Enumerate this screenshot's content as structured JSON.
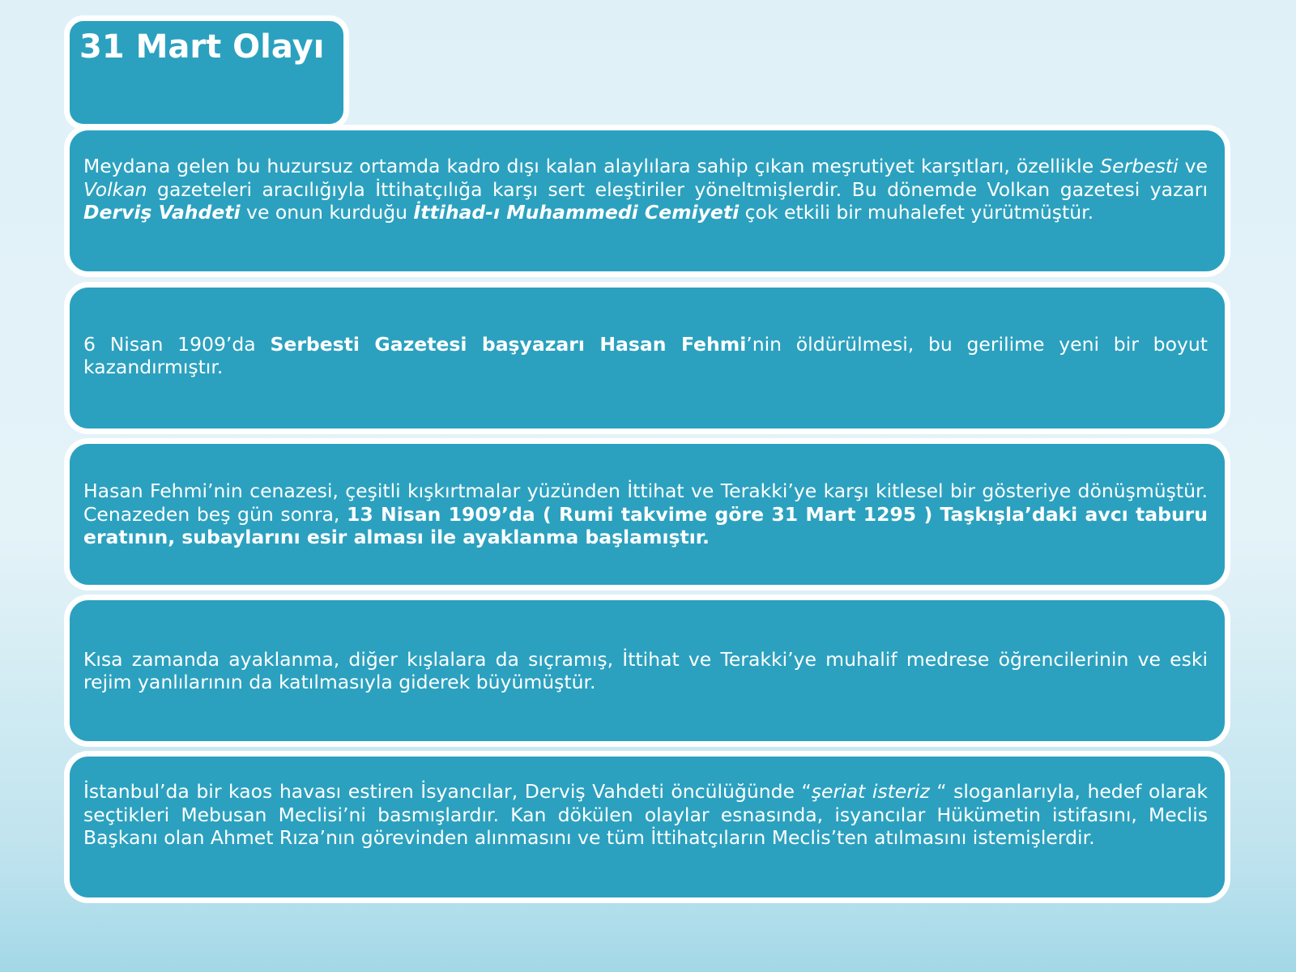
{
  "title": "31 Mart Olayı",
  "cards": [
    {
      "runs": [
        {
          "text": "Meydana gelen bu huzursuz ortamda kadro dışı kalan alaylılara sahip çıkan meşrutiyet karşıtları, özellikle ",
          "style": ""
        },
        {
          "text": "Serbesti",
          "style": "it"
        },
        {
          "text": " ve ",
          "style": ""
        },
        {
          "text": "Volkan",
          "style": "it"
        },
        {
          "text": " gazeteleri aracılığıyla İttihatçılığa karşı sert eleştiriler yöneltmişlerdir. Bu dönemde Volkan gazetesi yazarı ",
          "style": ""
        },
        {
          "text": "Derviş Vahdeti",
          "style": "bdit"
        },
        {
          "text": " ve onun kurduğu ",
          "style": ""
        },
        {
          "text": "İttihad-ı Muhammedi Cemiyeti",
          "style": "bdit"
        },
        {
          "text": " çok etkili bir muhalefet yürütmüştür.",
          "style": ""
        }
      ]
    },
    {
      "runs": [
        {
          "text": "6 Nisan 1909’da ",
          "style": ""
        },
        {
          "text": "Serbesti Gazetesi başyazarı Hasan Fehmi",
          "style": "bd"
        },
        {
          "text": "’nin öldürülmesi, bu gerilime yeni bir boyut kazandırmıştır.",
          "style": ""
        }
      ]
    },
    {
      "runs": [
        {
          "text": "Hasan Fehmi’nin cenazesi, çeşitli kışkırtmalar yüzünden İttihat ve Terakki’ye karşı kitlesel bir gösteriye dönüşmüştür. Cenazeden beş gün sonra, ",
          "style": ""
        },
        {
          "text": "13 Nisan 1909’da ( Rumi takvime göre 31 Mart 1295 ) Taşkışla’daki avcı taburu eratının, subaylarını esir alması ile ayaklanma başlamıştır.",
          "style": "bd"
        }
      ]
    },
    {
      "runs": [
        {
          "text": "Kısa zamanda ayaklanma, diğer kışlalara da sıçramış,  İttihat ve Terakki’ye muhalif medrese öğrencilerinin ve eski rejim yanlılarının da katılmasıyla giderek büyümüştür.",
          "style": ""
        }
      ]
    },
    {
      "runs": [
        {
          "text": "İstanbul’da bir kaos havası estiren İsyancılar, Derviş Vahdeti öncülüğünde “",
          "style": ""
        },
        {
          "text": "şeriat isteriz",
          "style": "it"
        },
        {
          "text": " “ sloganlarıyla, hedef olarak seçtikleri Mebusan Meclisi’ni basmışlardır. Kan dökülen olaylar esnasında, isyancılar Hükümetin istifasını, Meclis Başkanı olan Ahmet Rıza’nın görevinden alınmasını ve tüm İttihatçıların Meclis’ten atılmasını istemişlerdir.",
          "style": ""
        }
      ]
    }
  ]
}
